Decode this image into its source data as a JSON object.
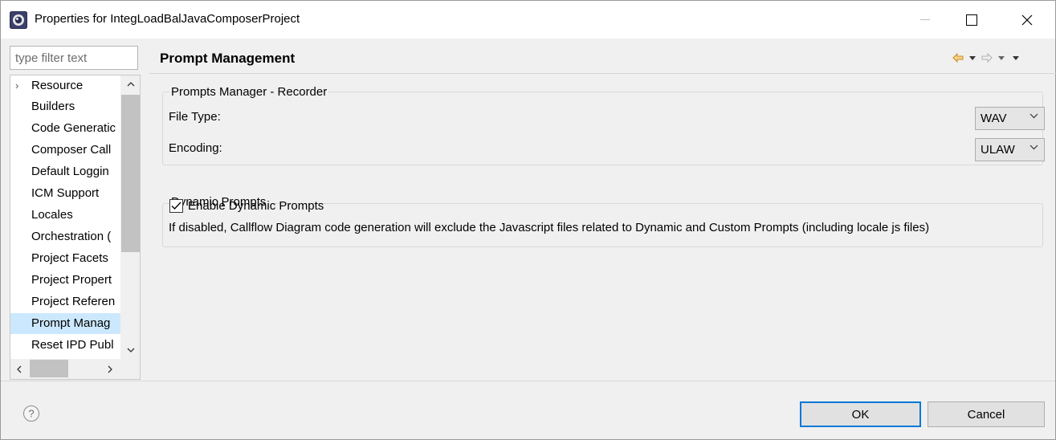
{
  "window": {
    "title": "Properties for IntegLoadBalJavaComposerProject",
    "icons": {
      "app": "eclipse-icon",
      "minimize": "minimize-icon",
      "maximize": "maximize-icon",
      "close": "close-icon"
    }
  },
  "sidebar": {
    "filter_placeholder": "type filter text",
    "items": [
      {
        "label": "Resource",
        "expandable": true
      },
      {
        "label": "Builders"
      },
      {
        "label": "Code Generatic"
      },
      {
        "label": "Composer Call"
      },
      {
        "label": "Default Loggin"
      },
      {
        "label": "ICM Support"
      },
      {
        "label": "Locales"
      },
      {
        "label": "Orchestration ("
      },
      {
        "label": "Project Facets"
      },
      {
        "label": "Project Propert"
      },
      {
        "label": "Project Referen"
      },
      {
        "label": "Prompt Manag",
        "selected": true
      },
      {
        "label": "Reset IPD Publ"
      },
      {
        "label": ""
      }
    ],
    "scroll_icons": {
      "up": "chevron-up-icon",
      "down": "chevron-down-icon",
      "left": "chevron-left-icon",
      "right": "chevron-right-icon"
    }
  },
  "page": {
    "title": "Prompt Management",
    "nav_icons": [
      "back-arrow-icon",
      "dropdown-icon",
      "forward-arrow-icon",
      "dropdown-icon",
      "menu-icon"
    ],
    "recorder_group": {
      "legend": "Prompts Manager - Recorder",
      "file_type_label": "File Type:",
      "file_type_value": "WAV",
      "encoding_label": "Encoding:",
      "encoding_value": "ULAW"
    },
    "dynamic_group": {
      "legend": "Dynamic Prompts",
      "checkbox_label": "Enable Dynamic Prompts",
      "checked": true,
      "note": "If disabled, Callflow Diagram code generation will exclude the Javascript files related to Dynamic and Custom Prompts (including locale js files)"
    }
  },
  "footer": {
    "help_icon": "help-icon",
    "ok_label": "OK",
    "cancel_label": "Cancel"
  },
  "colors": {
    "selection": "#cce8ff",
    "default_button_border": "#0078d7",
    "nav_arrow": "#e8a33a"
  }
}
